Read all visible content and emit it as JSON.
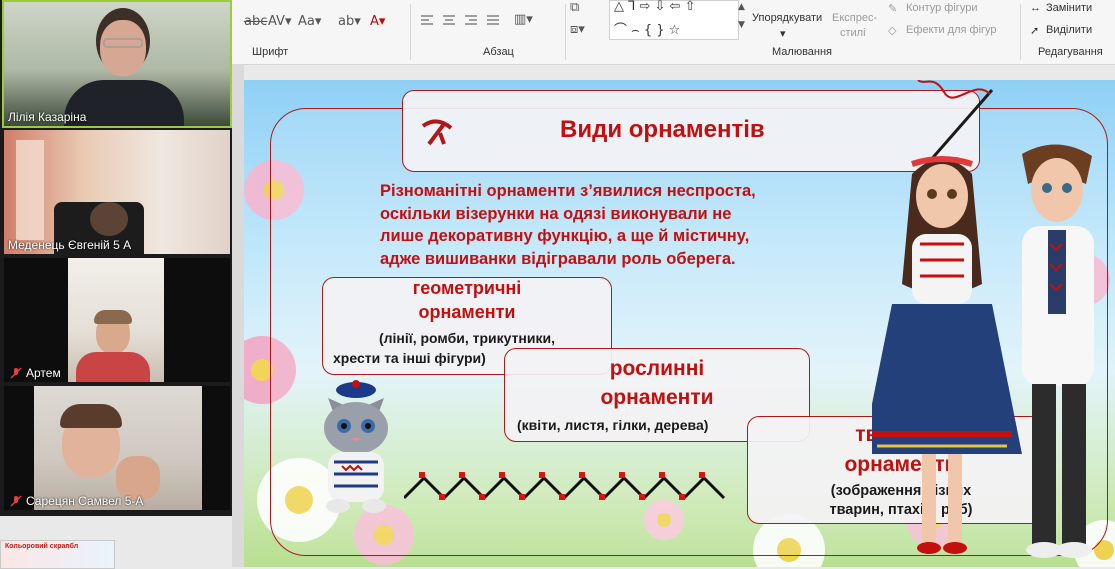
{
  "ribbon": {
    "groups": {
      "font": "Шрифт",
      "paragraph": "Абзац",
      "drawing": "Малювання",
      "editing": "Редагування"
    },
    "arrange_label": "Упорядкувати",
    "quick_styles_line1": "Експрес-",
    "quick_styles_line2": "стилі",
    "shape_outline": "Контур фігури",
    "shape_effects": "Ефекти для фігур",
    "replace": "Замінити",
    "select": "Виділити"
  },
  "participants": [
    {
      "name": "Лілія Казаріна",
      "muted": false
    },
    {
      "name": "Меденець Євгеній 5 А",
      "muted": false
    },
    {
      "name": "Артем",
      "muted": true
    },
    {
      "name": "Сарецян Самвел 5-А",
      "muted": true
    }
  ],
  "thumbnail": {
    "title": "Кольоровий скрапбл"
  },
  "slide": {
    "title": "Види орнаментів",
    "intro": [
      "Різноманітні орнаменти з’явилися неспроста,",
      "оскільки візерунки на одязі виконували не",
      "лише декоративну функцію, а ще й містичну,",
      "адже вишиванки відігравали роль оберега."
    ],
    "boxes": {
      "geometric": {
        "title1": "геометричні",
        "title2": "орнаменти",
        "desc1": "(лінії, ромби, трикутники,",
        "desc2": "хрести та інші фігури)"
      },
      "floral": {
        "title1": "рослинні",
        "title2": "орнаменти",
        "desc": "(квіти, листя, гілки, дерева)"
      },
      "animal": {
        "title1": "тваринні",
        "title2": "орнаменти",
        "desc1": "(зображення різних",
        "desc2": "тварин, птахів, риб)"
      }
    }
  },
  "colors": {
    "accent_red": "#c40f0f",
    "box_border": "#b01818"
  }
}
